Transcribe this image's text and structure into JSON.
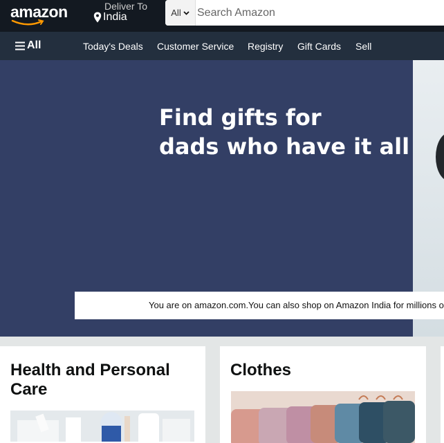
{
  "header": {
    "logo_text": "amazon",
    "deliver_to_label": "Deliver To",
    "deliver_location": "India",
    "search_category": "All",
    "search_placeholder": "Search Amazon"
  },
  "nav": {
    "all_label": "All",
    "items": [
      "Today's Deals",
      "Customer Service",
      "Registry",
      "Gift Cards",
      "Sell"
    ]
  },
  "hero": {
    "title_line1": "Find gifts for",
    "title_line2": "dads who have it all",
    "notice": "You are on amazon.com.You can also shop on Amazon India for millions of products with fast local delivery."
  },
  "cards": [
    {
      "title": "Health and Personal Care"
    },
    {
      "title": "Clothes"
    }
  ],
  "colors": {
    "header_bg": "#131921",
    "nav_bg": "#232f3e",
    "hero_bg": "#333f65",
    "page_bg": "#e3e6e6",
    "smile_orange": "#ff9900"
  }
}
